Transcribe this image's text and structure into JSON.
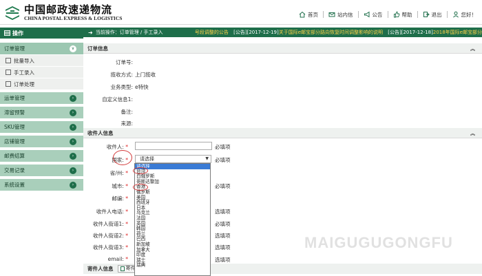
{
  "logo": {
    "cn": "中国邮政速递物流",
    "en": "CHINA POSTAL EXPRESS & LOGISTICS"
  },
  "topnav": [
    {
      "label": "首页",
      "icon": "home-icon"
    },
    {
      "label": "站内信",
      "icon": "mail-icon"
    },
    {
      "label": "公告",
      "icon": "bullhorn-icon"
    },
    {
      "label": "帮助",
      "icon": "thumbs-up-icon"
    },
    {
      "label": "退出",
      "icon": "logout-icon"
    },
    {
      "label": "您好！",
      "icon": "user-icon"
    }
  ],
  "sidebar": {
    "title": "操作",
    "groups": [
      {
        "label": "订单管理",
        "open": true,
        "items": [
          "批量导入",
          "手工录入",
          "订单处理"
        ]
      },
      {
        "label": "运单管理"
      },
      {
        "label": "滞留预警"
      },
      {
        "label": "SKU管理"
      },
      {
        "label": "店铺管理"
      },
      {
        "label": "邮费结算"
      },
      {
        "label": "交易记录"
      },
      {
        "label": "系统设置"
      }
    ]
  },
  "crumbbar": {
    "crumb": "当前操作：订单管理 / 手工录入",
    "notice1": "号段调整的公告",
    "notice2_prefix": "[公告][2017-12-19]",
    "notice2": "关于国际e邮宝部分路向恢复时间调整影响的说明",
    "notice3_prefix": "[公告][2017-12-18]",
    "notice3": "2018年国际e邮宝部分"
  },
  "order_info": {
    "title": "订单信息",
    "fields": [
      {
        "label": "订单号:",
        "value": ""
      },
      {
        "label": "揽收方式:",
        "value": "上门揽收"
      },
      {
        "label": "业务类型:",
        "value": "e特快"
      },
      {
        "label": "自定义信息1:",
        "value": ""
      },
      {
        "label": "备注:",
        "value": ""
      },
      {
        "label": "来源:",
        "value": ""
      }
    ]
  },
  "recipient": {
    "title": "收件人信息",
    "name_label": "收件人:",
    "country_label": "国家:",
    "country_placeholder": "请选择",
    "province_label": "省/州:",
    "city_label": "城市:",
    "zip_label": "邮编:",
    "phone_label": "收件人电话:",
    "street1_label": "收件人街道1:",
    "street2_label": "收件人街道2:",
    "street3_label": "收件人街道3:",
    "email_label": "email:",
    "required": "必填项",
    "optional": "选填项"
  },
  "sender": {
    "title": "寄件人信息",
    "button": "寄件"
  },
  "country_options": [
    "请选择",
    "台湾",
    "白俄罗斯",
    "哥斯达黎加",
    "香港",
    "俄罗斯",
    "美国",
    "西班牙",
    "日本",
    "乌克兰",
    "法国",
    "英国",
    "韩国",
    "荷兰",
    "巴西",
    "新加坡",
    "加拿大",
    "印度",
    "瑞士",
    "瑞典"
  ],
  "watermark": "MAIGUGUGONGFU",
  "colors": {
    "brand": "#1e6e4a",
    "menu": "#a9cfbb",
    "notice": "#ffd24a",
    "annotation": "#d23a3a"
  }
}
